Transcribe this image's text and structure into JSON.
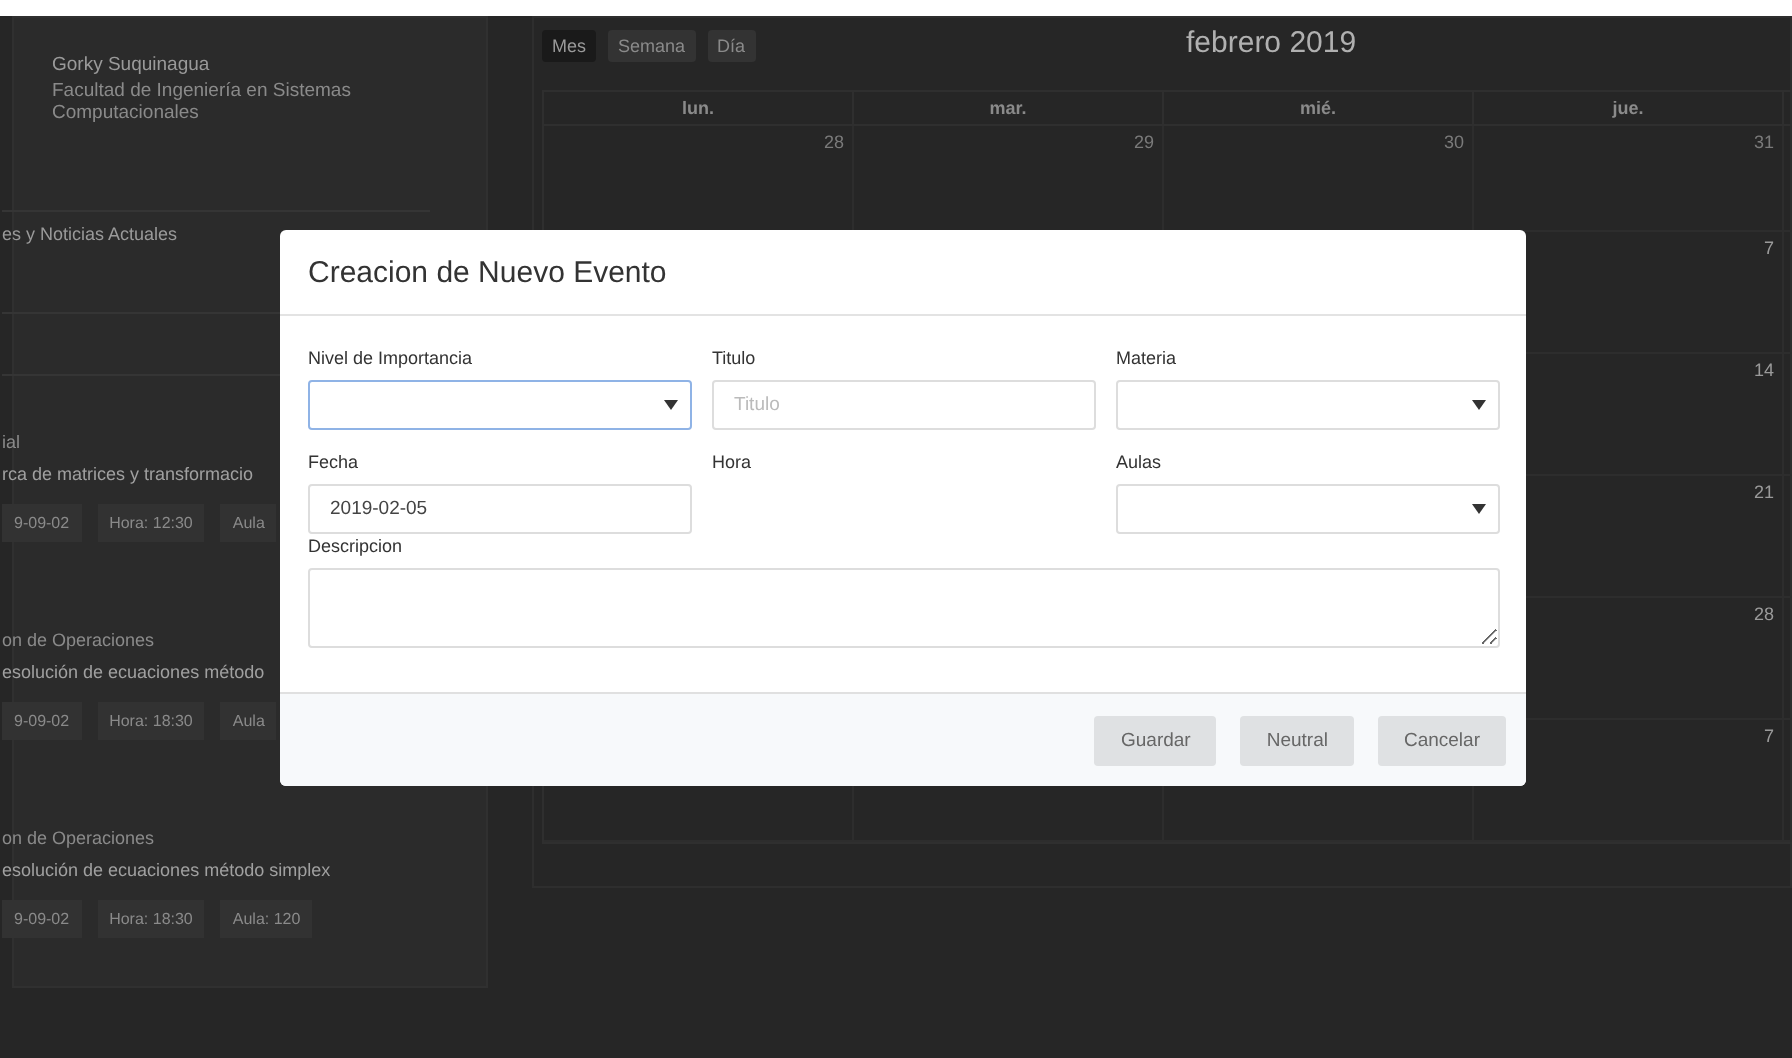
{
  "profile": {
    "name": "Gorky Suquinagua",
    "faculty": "Facultad de Ingeniería en Sistemas Computacionales"
  },
  "news_heading": "es y Noticias Actuales",
  "events": [
    {
      "category": "ial",
      "title": "rca de matrices y transformacio",
      "tags": [
        "9-09-02",
        "Hora: 12:30",
        "Aula"
      ]
    },
    {
      "category": "on de Operaciones",
      "title": "esolución de ecuaciones método",
      "tags": [
        "9-09-02",
        "Hora: 18:30",
        "Aula"
      ]
    },
    {
      "category": "on de Operaciones",
      "title": "esolución de ecuaciones método simplex",
      "tags": [
        "9-09-02",
        "Hora: 18:30",
        "Aula: 120"
      ]
    }
  ],
  "calendar": {
    "views": [
      {
        "label": "Mes",
        "selected": true
      },
      {
        "label": "Semana",
        "selected": false
      },
      {
        "label": "Día",
        "selected": false
      }
    ],
    "title": "febrero 2019",
    "weekdays": [
      "lun.",
      "mar.",
      "mié.",
      "jue."
    ],
    "weeks": [
      {
        "days": [
          "28",
          "29",
          "30",
          "31"
        ]
      },
      {
        "days": [
          "7"
        ]
      },
      {
        "days": [
          "14"
        ]
      },
      {
        "days": [
          "21"
        ]
      },
      {
        "days": [
          "28"
        ]
      },
      {
        "days": [
          "7"
        ]
      }
    ]
  },
  "modal": {
    "title": "Creacion de Nuevo Evento",
    "fields": [
      {
        "label": "Nivel de Importancia",
        "kind": "select",
        "focused": true
      },
      {
        "label": "Titulo",
        "kind": "text",
        "placeholder": "Titulo"
      },
      {
        "label": "Materia",
        "kind": "select",
        "focused": false
      },
      {
        "label": "Fecha",
        "kind": "text",
        "value": "2019-02-05"
      },
      {
        "label": "Hora",
        "kind": "none"
      },
      {
        "label": "Aulas",
        "kind": "select",
        "focused": false
      }
    ],
    "description_label": "Descripcion",
    "buttons": [
      "Guardar",
      "Neutral",
      "Cancelar"
    ]
  }
}
